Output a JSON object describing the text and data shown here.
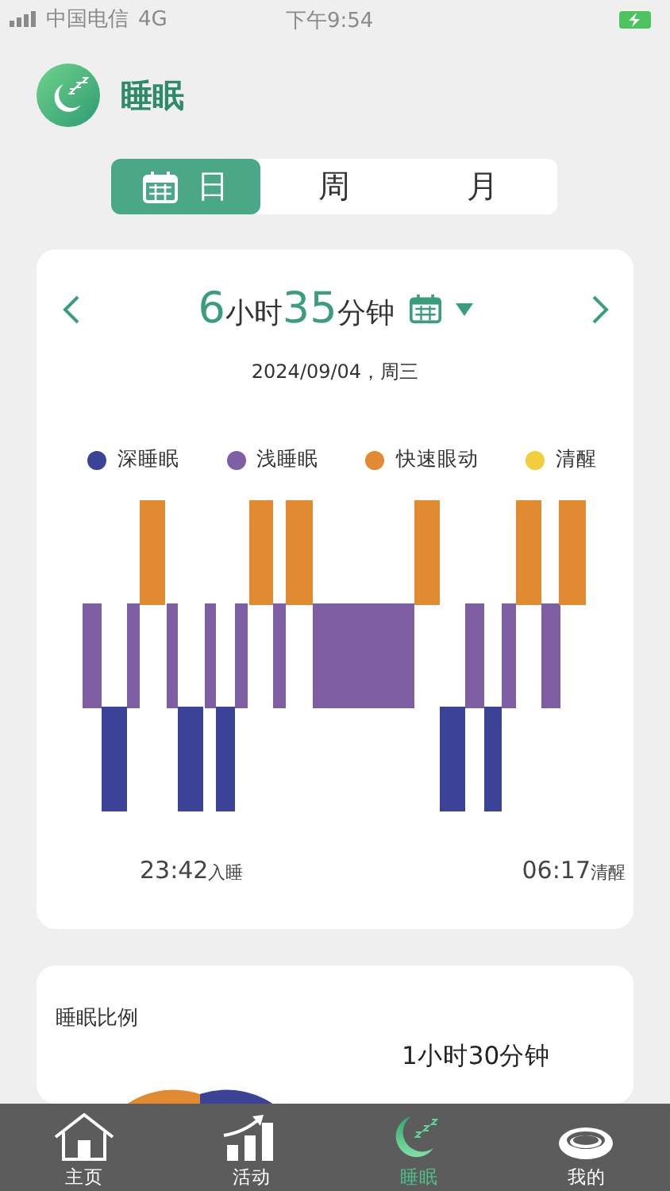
{
  "status_bar": {
    "carrier": "中国电信",
    "network": "4G",
    "time": "下午9:54"
  },
  "header": {
    "title": "睡眠"
  },
  "tabs": [
    {
      "label": "日",
      "selected": true
    },
    {
      "label": "周",
      "selected": false
    },
    {
      "label": "月",
      "selected": false
    }
  ],
  "summary": {
    "hours": "6",
    "hours_unit": "小时",
    "minutes": "35",
    "minutes_unit": "分钟",
    "date": "2024/09/04，周三"
  },
  "legend": [
    {
      "label": "深睡眠",
      "color": "#3b4396"
    },
    {
      "label": "浅睡眠",
      "color": "#7f5fa3"
    },
    {
      "label": "快速眼动",
      "color": "#e28a31"
    },
    {
      "label": "清醒",
      "color": "#f2cd3c"
    }
  ],
  "timeline": {
    "start_time": "23:42",
    "start_label": "入睡",
    "end_time": "06:17",
    "end_label": "清醒"
  },
  "ratio_card": {
    "title": "睡眠比例",
    "duration": "1小时30分钟"
  },
  "nav": [
    {
      "label": "主页",
      "selected": false
    },
    {
      "label": "活动",
      "selected": false
    },
    {
      "label": "睡眠",
      "selected": true
    },
    {
      "label": "我的",
      "selected": false
    }
  ]
}
